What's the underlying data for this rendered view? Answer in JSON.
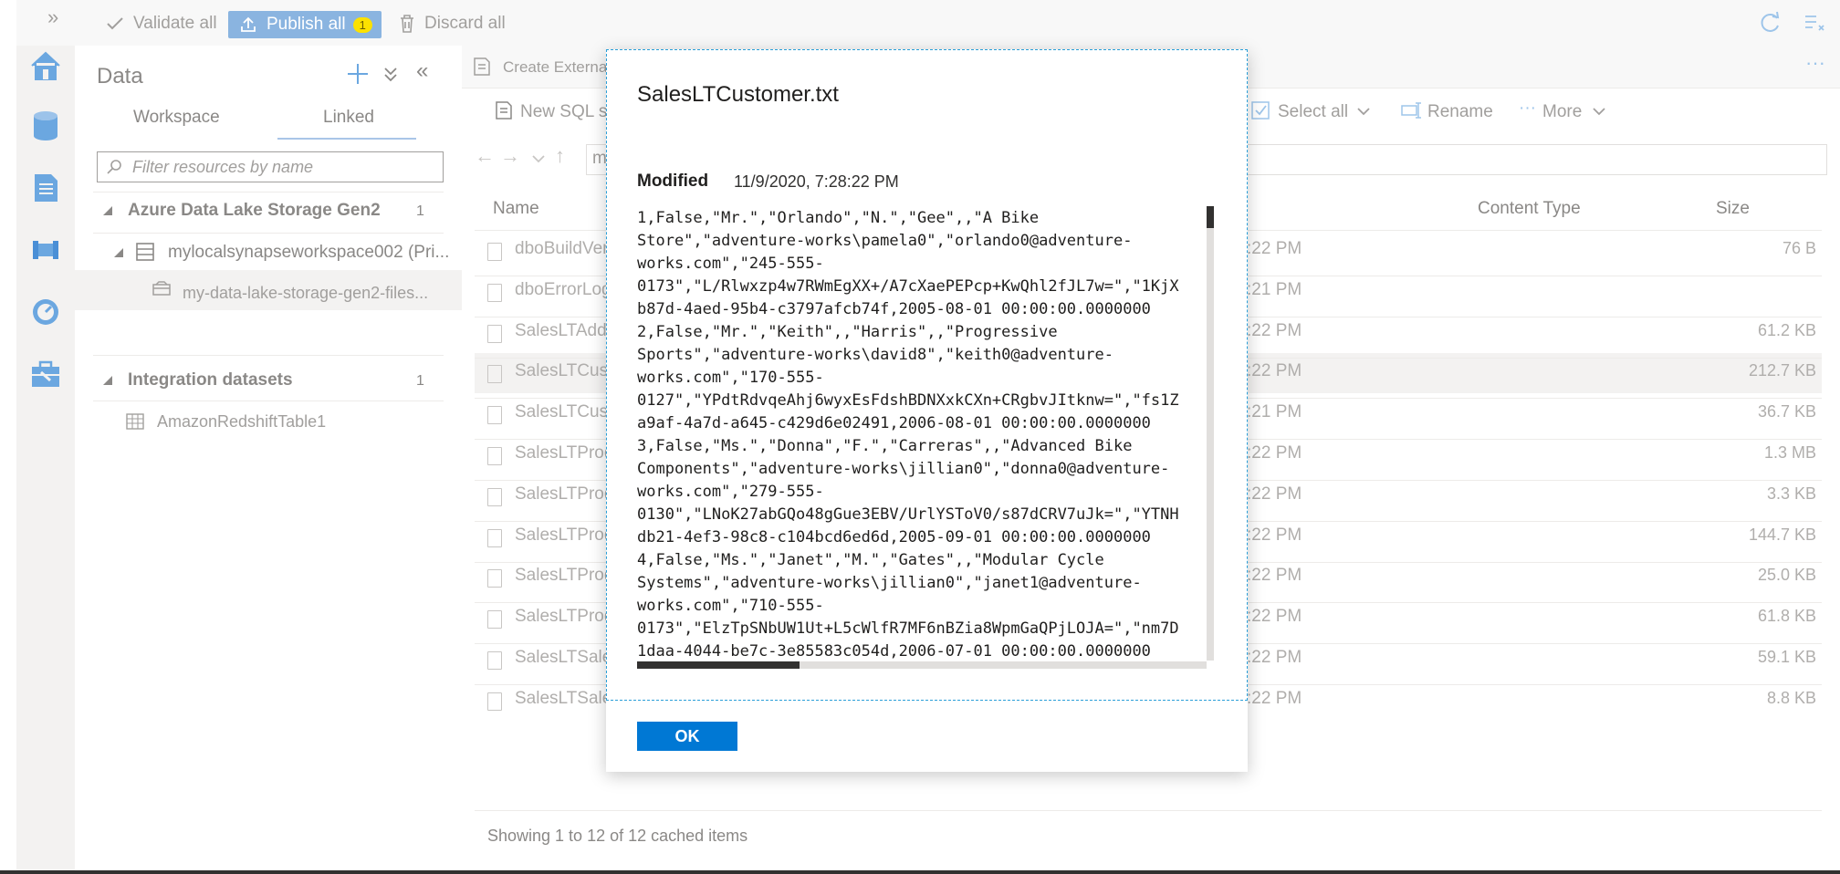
{
  "toolbar": {
    "validate_all": "Validate all",
    "publish_all": "Publish all",
    "publish_count": "1",
    "discard_all": "Discard all"
  },
  "data_pane": {
    "title": "Data",
    "tabs": [
      "Workspace",
      "Linked"
    ],
    "active_tab": "Linked",
    "filter_placeholder": "Filter resources by name",
    "tree": {
      "adls_group": "Azure Data Lake Storage Gen2",
      "adls_count": "1",
      "workspace_node": "mylocalsynapseworkspace002 (Pri...",
      "filesystem_node": "my-data-lake-storage-gen2-files...",
      "datasets_group": "Integration datasets",
      "datasets_count": "1",
      "dataset_item": "AmazonRedshiftTable1"
    }
  },
  "main": {
    "create_external": "Create External",
    "new_sql_script": "New SQL sc",
    "select_all": "Select all",
    "rename": "Rename",
    "more": "More",
    "path_prefix": "m",
    "columns": {
      "name": "Name",
      "content_type": "Content Type",
      "size": "Size"
    },
    "rows": [
      {
        "name": "dboBuildVer",
        "date": ":22 PM",
        "size": "76 B"
      },
      {
        "name": "dboErrorLog",
        "date": ":21 PM",
        "size": ""
      },
      {
        "name": "SalesLTAddre",
        "date": ":22 PM",
        "size": "61.2 KB"
      },
      {
        "name": "SalesLTCusto",
        "date": ":22 PM",
        "size": "212.7 KB"
      },
      {
        "name": "SalesLTCusto",
        "date": ":21 PM",
        "size": "36.7 KB"
      },
      {
        "name": "SalesLTProdu",
        "date": ":22 PM",
        "size": "1.3 MB"
      },
      {
        "name": "SalesLTProdu",
        "date": ":22 PM",
        "size": "3.3 KB"
      },
      {
        "name": "SalesLTProdu",
        "date": ":22 PM",
        "size": "144.7 KB"
      },
      {
        "name": "SalesLTProdu",
        "date": ":22 PM",
        "size": "25.0 KB"
      },
      {
        "name": "SalesLTProdu",
        "date": ":22 PM",
        "size": "61.8 KB"
      },
      {
        "name": "SalesLTSales",
        "date": ":22 PM",
        "size": "59.1 KB"
      },
      {
        "name": "SalesLTSales",
        "date": ":22 PM",
        "size": "8.8 KB"
      }
    ],
    "footer": "Showing 1 to 12 of 12 cached items"
  },
  "dialog": {
    "title": "SalesLTCustomer.txt",
    "modified_label": "Modified",
    "modified_value": "11/9/2020, 7:28:22 PM",
    "content_lines": [
      "1,False,\"Mr.\",\"Orlando\",\"N.\",\"Gee\",,\"A Bike",
      "Store\",\"adventure-works\\pamela0\",\"orlando0@adventure-",
      "works.com\",\"245-555-",
      "0173\",\"L/Rlwxzp4w7RWmEgXX+/A7cXaePEPcp+KwQhl2fJL7w=\",\"1KjX",
      "b87d-4aed-95b4-c3797afcb74f,2005-08-01 00:00:00.0000000",
      "2,False,\"Mr.\",\"Keith\",,\"Harris\",,\"Progressive",
      "Sports\",\"adventure-works\\david8\",\"keith0@adventure-",
      "works.com\",\"170-555-",
      "0127\",\"YPdtRdvqeAhj6wyxEsFdshBDNXxkCXn+CRgbvJItknw=\",\"fs1Z",
      "a9af-4a7d-a645-c429d6e02491,2006-08-01 00:00:00.0000000",
      "3,False,\"Ms.\",\"Donna\",\"F.\",\"Carreras\",,\"Advanced Bike",
      "Components\",\"adventure-works\\jillian0\",\"donna0@adventure-",
      "works.com\",\"279-555-",
      "0130\",\"LNoK27abGQo48gGue3EBV/UrlYSToV0/s87dCRV7uJk=\",\"YTNH",
      "db21-4ef3-98c8-c104bcd6ed6d,2005-09-01 00:00:00.0000000",
      "4,False,\"Ms.\",\"Janet\",\"M.\",\"Gates\",,\"Modular Cycle",
      "Systems\",\"adventure-works\\jillian0\",\"janet1@adventure-",
      "works.com\",\"710-555-",
      "0173\",\"ElzTpSNbUW1Ut+L5cWlfR7MF6nBZia8WpmGaQPjLOJA=\",\"nm7D",
      "1daa-4044-be7c-3e85583c054d,2006-07-01 00:00:00.0000000"
    ],
    "ok_label": "OK"
  }
}
